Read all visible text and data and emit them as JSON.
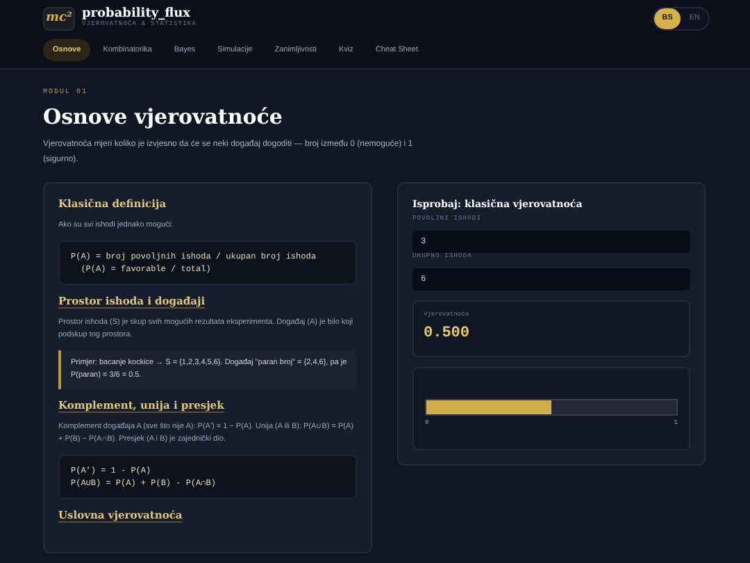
{
  "header": {
    "logo": "mc²",
    "title": "probability_flux",
    "subtitle": "VJEROVATNOĆA & STATISTIKA",
    "languages": [
      {
        "label": "BS",
        "selected": true
      },
      {
        "label": "EN",
        "selected": false
      }
    ]
  },
  "nav": [
    {
      "label": "Osnove",
      "selected": true
    },
    {
      "label": "Kombinatorika",
      "selected": false
    },
    {
      "label": "Bayes",
      "selected": false
    },
    {
      "label": "Simulacije",
      "selected": false
    },
    {
      "label": "Zanimljivosti",
      "selected": false
    },
    {
      "label": "Kviz",
      "selected": false
    },
    {
      "label": "Cheat Sheet",
      "selected": false
    }
  ],
  "module": {
    "label": "MODUL 01",
    "title": "Osnove vjerovatnoće",
    "intro": "Vjerovatnoća mjeri koliko je izvjesno da će se neki događaj dogoditi — broj između 0 (nemoguće) i 1 (sigurno)."
  },
  "sections": [
    {
      "kind": "code",
      "title": "Klasična definicija",
      "text": "Ako su svi ishodi jednako mogući:",
      "block": [
        "P(A) = broj povoljnih ishoda / ukupan broj ishoda",
        "  (P(A) = favorable / total)"
      ]
    },
    {
      "kind": "note",
      "title": "Prostor ishoda i događaji",
      "text": "Prostor ishoda (S) je skup svih mogućih rezultata eksperimenta. Događaj (A) je bilo koji podskup tog prostora.",
      "block": [
        "Primjer: bacanje kockice → S = {1,2,3,4,5,6}. Događaj \"paran broj\" = {2,4,6}, pa je P(paran) = 3/6 = 0.5."
      ]
    },
    {
      "kind": "code",
      "title": "Komplement, unija i presjek",
      "text": "Komplement događaja A (sve što nije A): P(A') = 1 − P(A). Unija (A ili B): P(A∪B) = P(A) + P(B) − P(A∩B). Presjek (A i B) je zajednički dio.",
      "block": [
        "P(A') = 1 - P(A)",
        "P(A∪B) = P(A) + P(B) - P(A∩B)"
      ]
    },
    {
      "kind": "heading",
      "title": "Uslovna vjerovatnoća"
    }
  ],
  "widget": {
    "title": "Isprobaj: klasična vjerovatnoća",
    "fields": [
      {
        "label": "POVOLJNI ISHODI",
        "value": "3"
      },
      {
        "label": "UKUPNO ISHODA",
        "value": "6"
      }
    ],
    "result_label": "Vjerovatnoća",
    "result": "0.500",
    "bar": {
      "level": 0.5,
      "min": "0",
      "max": "1"
    }
  }
}
